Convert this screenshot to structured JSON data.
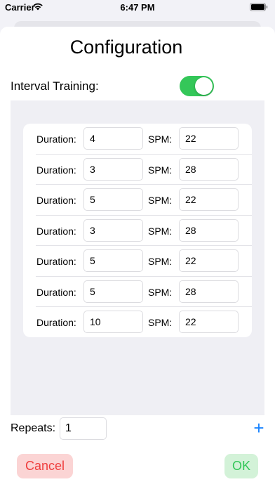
{
  "status_bar": {
    "carrier": "Carrier",
    "time": "6:47 PM"
  },
  "title": "Configuration",
  "interval_training": {
    "label": "Interval Training:",
    "enabled": true
  },
  "intervals": {
    "duration_label": "Duration:",
    "spm_label": "SPM:",
    "rows": [
      {
        "duration": "4",
        "spm": "22"
      },
      {
        "duration": "3",
        "spm": "28"
      },
      {
        "duration": "5",
        "spm": "22"
      },
      {
        "duration": "3",
        "spm": "28"
      },
      {
        "duration": "5",
        "spm": "22"
      },
      {
        "duration": "5",
        "spm": "28"
      },
      {
        "duration": "10",
        "spm": "22"
      }
    ]
  },
  "repeats": {
    "label": "Repeats:",
    "value": "1"
  },
  "add_icon": "plus-icon",
  "buttons": {
    "cancel": "Cancel",
    "ok": "OK"
  },
  "colors": {
    "toggle_on": "#34c759",
    "accent_blue": "#1a84ff",
    "cancel_text": "#ef3e3e",
    "cancel_bg": "#fbd4d4",
    "ok_text": "#34c759",
    "ok_bg": "#d3f2d8"
  }
}
